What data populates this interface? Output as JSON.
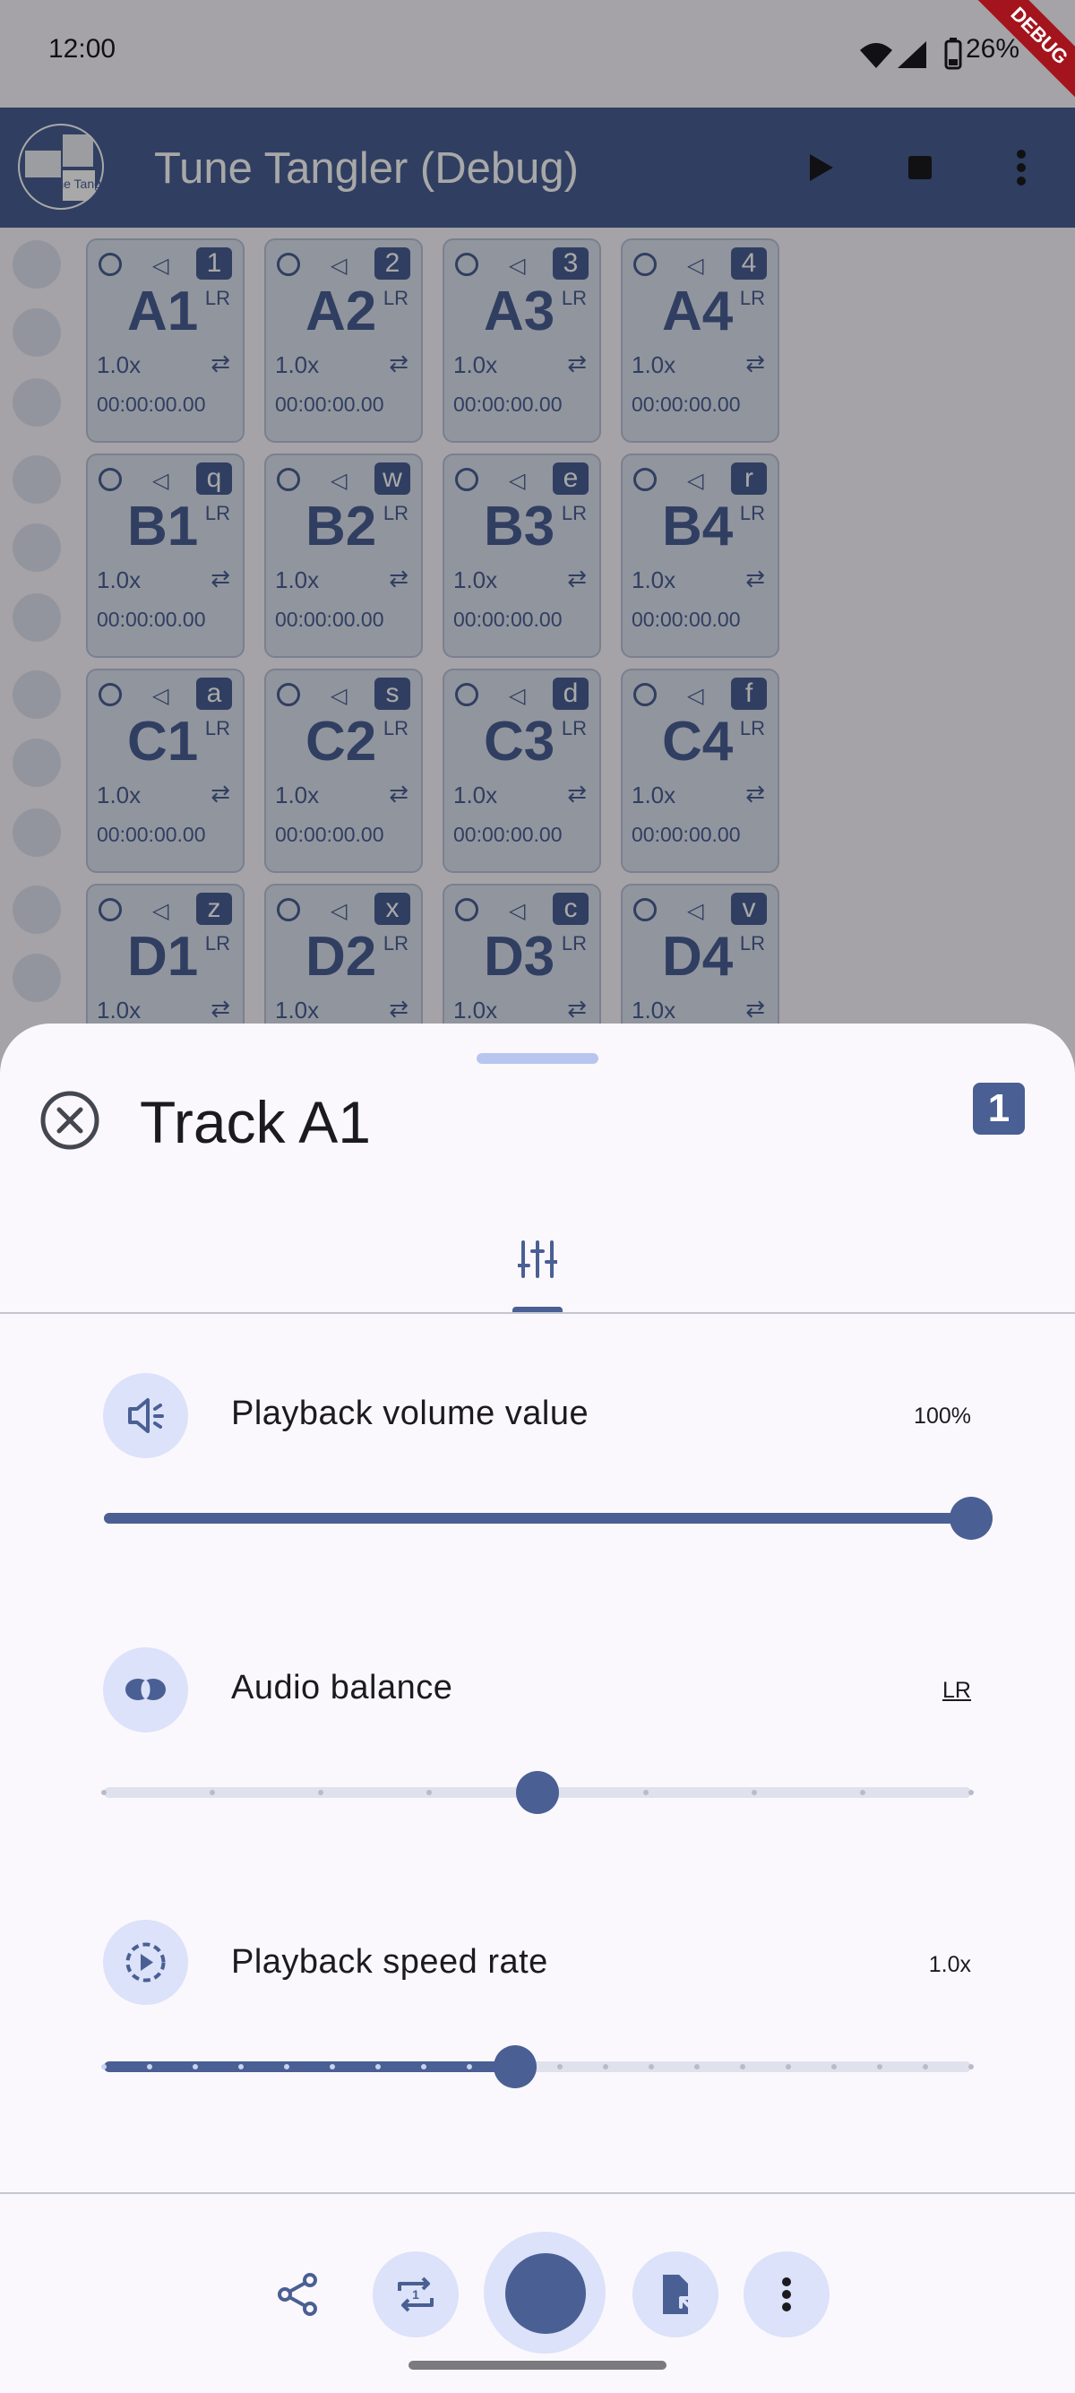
{
  "status_bar": {
    "time": "12:00",
    "battery": "26%"
  },
  "debug_banner": "DEBUG",
  "app_bar": {
    "title": "Tune Tangler (Debug)",
    "logo_text": "Tune Tangler"
  },
  "grid": {
    "rows": [
      {
        "pads": [
          {
            "name": "A1",
            "key": "1"
          },
          {
            "name": "A2",
            "key": "2"
          },
          {
            "name": "A3",
            "key": "3"
          },
          {
            "name": "A4",
            "key": "4"
          }
        ]
      },
      {
        "pads": [
          {
            "name": "B1",
            "key": "q"
          },
          {
            "name": "B2",
            "key": "w"
          },
          {
            "name": "B3",
            "key": "e"
          },
          {
            "name": "B4",
            "key": "r"
          }
        ]
      },
      {
        "pads": [
          {
            "name": "C1",
            "key": "a"
          },
          {
            "name": "C2",
            "key": "s"
          },
          {
            "name": "C3",
            "key": "d"
          },
          {
            "name": "C4",
            "key": "f"
          }
        ]
      },
      {
        "pads": [
          {
            "name": "D1",
            "key": "z"
          },
          {
            "name": "D2",
            "key": "x"
          },
          {
            "name": "D3",
            "key": "c"
          },
          {
            "name": "D4",
            "key": "v"
          }
        ]
      }
    ],
    "pad_speed": "1.0x",
    "pad_time": "00:00:00.00",
    "pad_balance": "LR"
  },
  "sheet": {
    "title": "Track A1",
    "badge": "1",
    "settings": {
      "volume": {
        "label": "Playback volume value",
        "value": "100%",
        "level": 1.0,
        "icon": "volume-icon"
      },
      "balance": {
        "label": "Audio balance",
        "value": "LR",
        "level": 0.5,
        "divisions": 8,
        "icon": "balance-icon"
      },
      "speed": {
        "label": "Playback speed rate",
        "value": "1.0x",
        "level": 0.474,
        "divisions": 19,
        "icon": "speed-icon"
      }
    }
  },
  "colors": {
    "primary": "#4a5f93",
    "container": "#dbe2f9",
    "surface": "#fbf8fd"
  }
}
